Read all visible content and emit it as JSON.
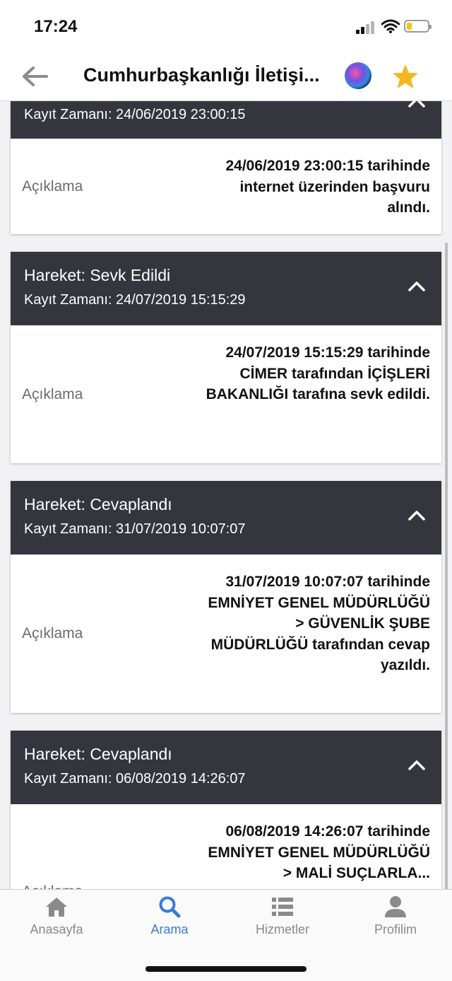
{
  "status_bar": {
    "time": "17:24",
    "battery_color": "#f5c61a"
  },
  "nav": {
    "title": "Cumhurbaşkanlığı İletişi...",
    "back_icon": "arrow-left-icon",
    "siri_icon": "siri-icon",
    "favorite_icon": "star-icon",
    "star_color": "#f5b623"
  },
  "records": [
    {
      "title": "",
      "time": "Kayıt Zamanı: 24/06/2019 23:00:15",
      "label": "Açıklama",
      "description": "24/06/2019 23:00:15 tarihinde internet üzerinden başvuru alındı."
    },
    {
      "title": "Hareket: Sevk Edildi",
      "time": "Kayıt Zamanı: 24/07/2019 15:15:29",
      "label": "Açıklama",
      "description": "24/07/2019 15:15:29 tarihinde CİMER tarafından İÇİŞLERİ BAKANLIĞI tarafına sevk edildi."
    },
    {
      "title": "Hareket: Cevaplandı",
      "time": "Kayıt Zamanı: 31/07/2019 10:07:07",
      "label": "Açıklama",
      "description": "31/07/2019 10:07:07 tarihinde EMNİYET GENEL MÜDÜRLÜĞÜ > GÜVENLİK ŞUBE MÜDÜRLÜĞÜ tarafından cevap yazıldı."
    },
    {
      "title": "Hareket: Cevaplandı",
      "time": "Kayıt Zamanı: 06/08/2019 14:26:07",
      "label": "Açıklama",
      "description": "06/08/2019 14:26:07 tarihinde EMNİYET GENEL MÜDÜRLÜĞÜ > MALİ SUÇLARLA..."
    }
  ],
  "tabs": [
    {
      "label": "Anasayfa",
      "icon": "home-icon",
      "active": false
    },
    {
      "label": "Arama",
      "icon": "search-icon",
      "active": true
    },
    {
      "label": "Hizmetler",
      "icon": "list-icon",
      "active": false
    },
    {
      "label": "Profilim",
      "icon": "person-icon",
      "active": false
    }
  ],
  "colors": {
    "header_bg": "#35363d",
    "active_tab": "#3b7bd1",
    "inactive_tab": "#8a8a8a"
  }
}
